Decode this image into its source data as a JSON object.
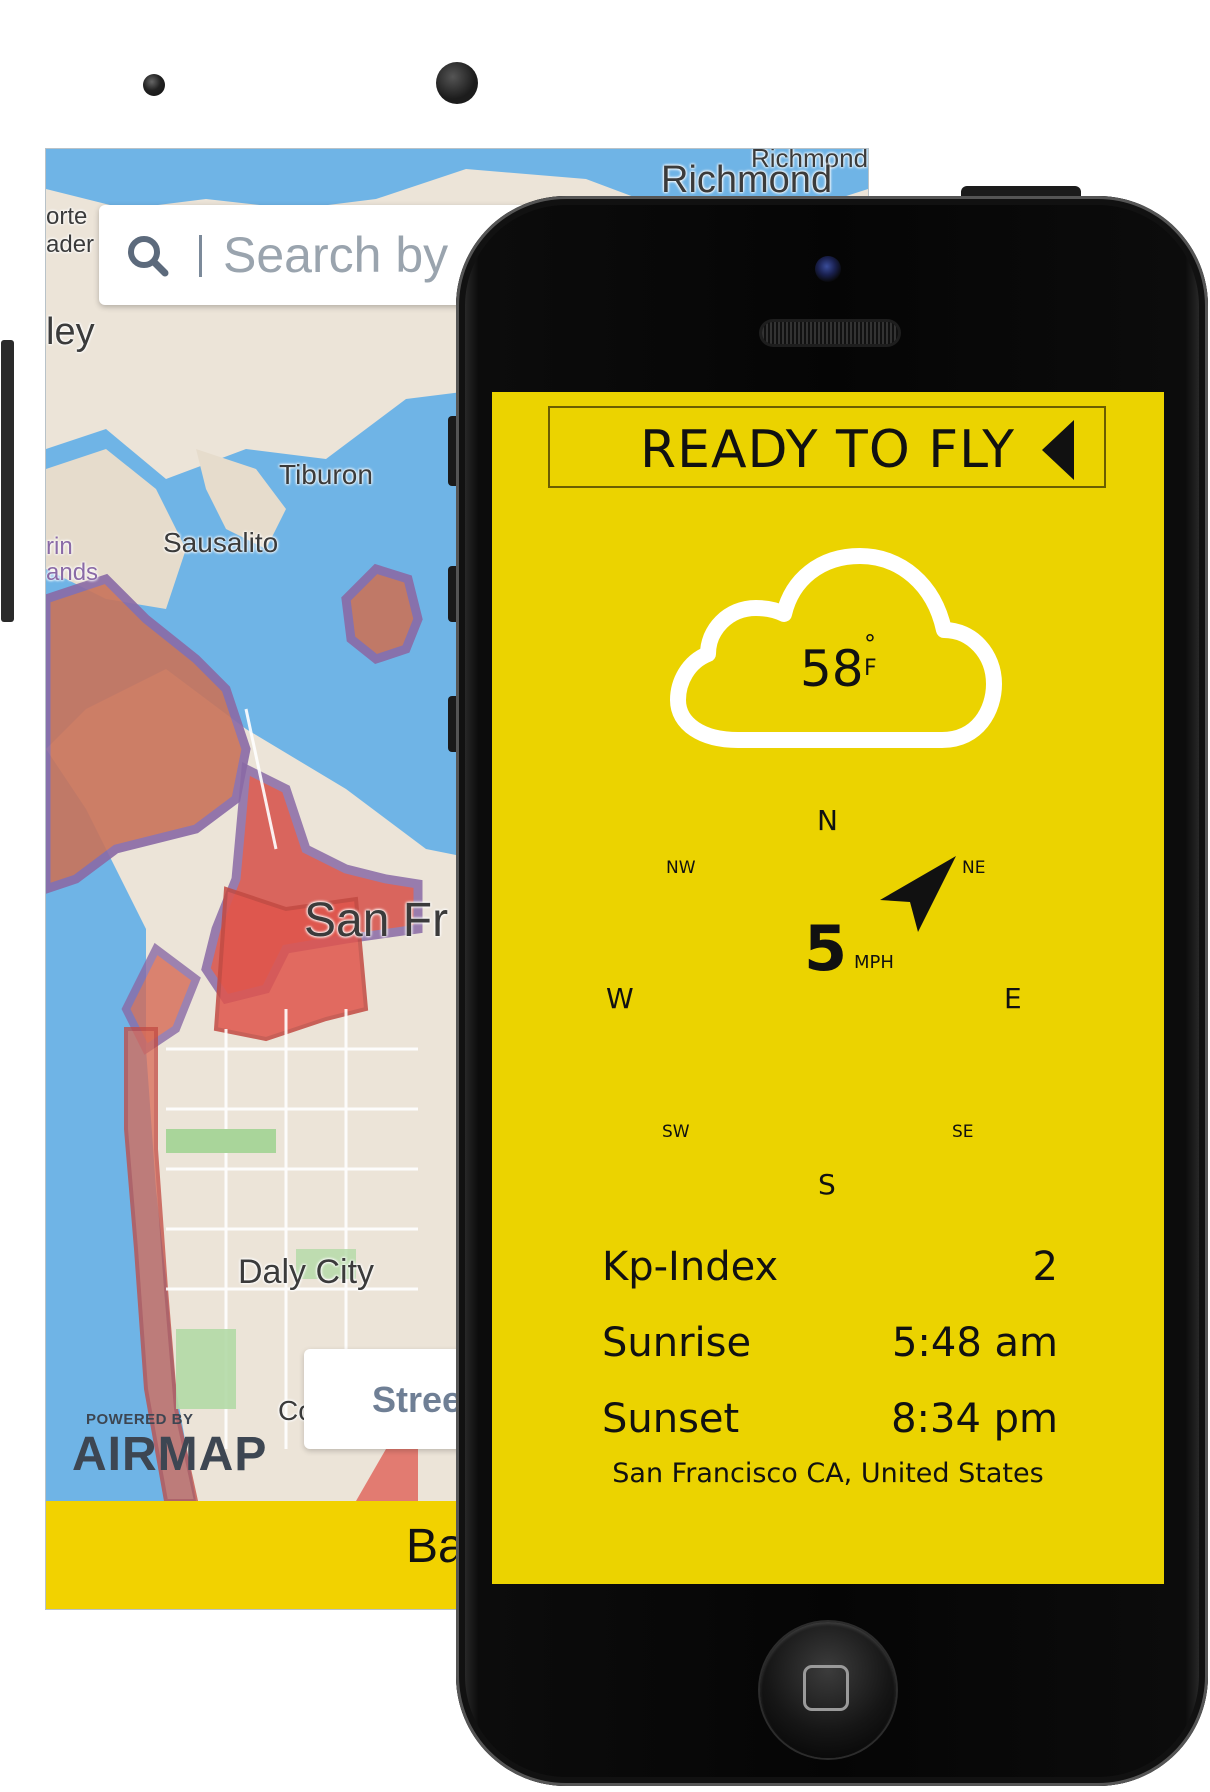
{
  "back_phone": {
    "search": {
      "placeholder": "Search by"
    },
    "map_labels": {
      "richmond_small": "Richmond",
      "richmond": "Richmond",
      "orte": "orte",
      "ader": "ader",
      "ley": "ley",
      "tiburon": "Tiburon",
      "sausalito": "Sausalito",
      "rin": "rin",
      "lands": "ands",
      "san_francisco": "San Fr",
      "daly_city": "Daly City",
      "co": "Co"
    },
    "street_button": "Stree",
    "branding": {
      "powered_by": "POWERED BY",
      "logo": "AIRMAP"
    },
    "bottom_bar": "Ba",
    "colors": {
      "water": "#6fb4e6",
      "land": "#ece4d8",
      "restricted_fill": "#c9564a",
      "restricted_border": "#8a6aa6",
      "bar": "#f2d200"
    }
  },
  "front_phone": {
    "status": "READY TO FLY",
    "temperature": {
      "value": "58",
      "degree": "°",
      "unit": "F"
    },
    "compass": {
      "n": "N",
      "ne": "NE",
      "e": "E",
      "se": "SE",
      "s": "S",
      "sw": "SW",
      "w": "W",
      "nw": "NW"
    },
    "wind": {
      "speed": "5",
      "unit": "MPH",
      "direction_icon": "navigation-arrow-icon"
    },
    "info": [
      {
        "label": "Kp-Index",
        "value": "2"
      },
      {
        "label": "Sunrise",
        "value": "5:48 am"
      },
      {
        "label": "Sunset",
        "value": "8:34 pm"
      }
    ],
    "location": "San Francisco CA, United States",
    "colors": {
      "screen": "#ebd300",
      "text": "#111111"
    }
  }
}
